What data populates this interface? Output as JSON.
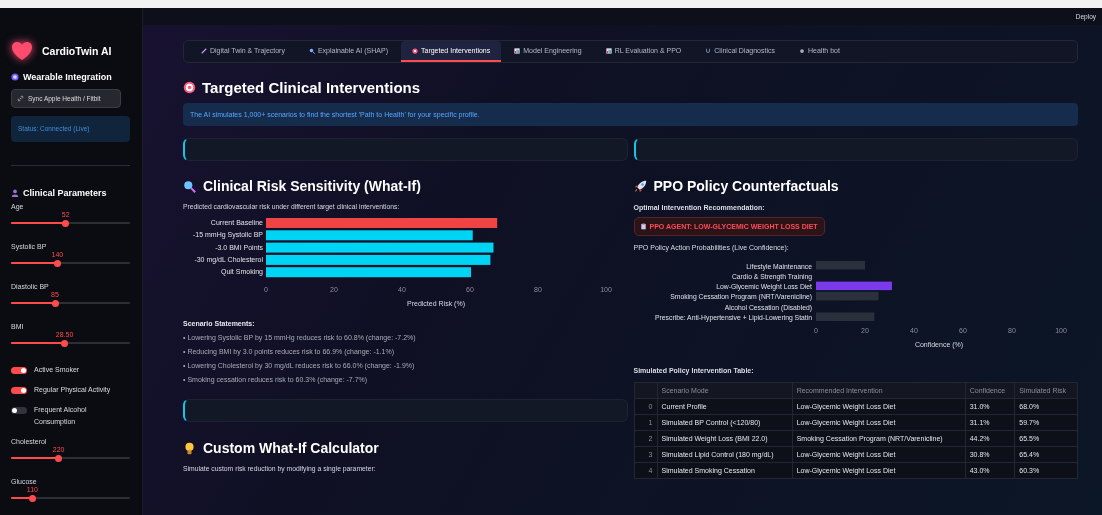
{
  "header": {
    "deploy": "Deploy"
  },
  "sidebar": {
    "app_title": "CardioTwin AI",
    "wearable_heading": "Wearable Integration",
    "sync_button": "Sync Apple Health / Fitbit",
    "status": "Status: Connected (Live)",
    "params_heading": "Clinical Parameters",
    "controls": [
      {
        "kind": "slider",
        "label": "Age",
        "value": "52",
        "level": 0.46
      },
      {
        "kind": "slider",
        "label": "Systolic BP",
        "value": "140",
        "level": 0.39
      },
      {
        "kind": "slider",
        "label": "Diastolic BP",
        "value": "85",
        "level": 0.37
      },
      {
        "kind": "slider",
        "label": "BMI",
        "value": "28.50",
        "level": 0.45
      },
      {
        "kind": "toggle",
        "label": "Active Smoker",
        "on": true
      },
      {
        "kind": "toggle",
        "label": "Regular Physical Activity",
        "on": true
      },
      {
        "kind": "toggle",
        "label": "Frequent Alcohol Consumption",
        "on": false
      },
      {
        "kind": "slider",
        "label": "Cholesterol",
        "value": "220",
        "level": 0.4
      },
      {
        "kind": "slider",
        "label": "Glucose",
        "value": "110",
        "level": 0.18
      }
    ]
  },
  "tabs": [
    {
      "label": "Digital Twin & Trajectory",
      "selected": false
    },
    {
      "label": "Explainable AI (SHAP)",
      "selected": false
    },
    {
      "label": "Targeted Interventions",
      "selected": true
    },
    {
      "label": "Model Engineering",
      "selected": false
    },
    {
      "label": "RL Evaluation & PPO",
      "selected": false
    },
    {
      "label": "Clinical Diagnostics",
      "selected": false
    },
    {
      "label": "Health bot",
      "selected": false
    }
  ],
  "page": {
    "title": "Targeted Clinical Interventions",
    "info": "The AI simulates 1,000+ scenarios to find the shortest 'Path to Health' for your specific profile."
  },
  "left": {
    "title": "Clinical Risk Sensitivity (What-If)",
    "subtitle": "Predicted cardiovascular risk under different target clinical interventions:",
    "chart_data": {
      "type": "bar",
      "orientation": "horizontal",
      "xlabel": "Predicted Risk (%)",
      "categories": [
        "Current Baseline",
        "-15 mmHg Systolic BP",
        "-3.0 BMI Points",
        "-30 mg/dL Cholesterol",
        "Quit Smoking"
      ],
      "xlim": [
        0,
        100
      ],
      "xticks": [
        0,
        20,
        40,
        60,
        80,
        100
      ],
      "series": [
        {
          "color": "#ef4444",
          "values": [
            68.0,
            null,
            null,
            null,
            null
          ]
        },
        {
          "color": "#00d4f5",
          "values": [
            null,
            60.8,
            66.9,
            66.0,
            60.3
          ]
        }
      ]
    },
    "statements_heading": "Scenario Statements:",
    "statements": [
      "• Lowering Systolic BP by 15 mmHg reduces risk to 60.8% (change: -7.2%)",
      "• Reducing BMI by 3.0 points reduces risk to 66.9% (change: -1.1%)",
      "• Lowering Cholesterol by 30 mg/dL reduces risk to 66.0% (change: -1.9%)",
      "• Smoking cessation reduces risk to 60.3% (change: -7.7%)"
    ],
    "calc_title": "Custom What-If Calculator",
    "calc_subtitle": "Simulate custom risk reduction by modifying a single parameter:"
  },
  "right": {
    "title": "PPO Policy Counterfactuals",
    "recommendation_label": "Optimal Intervention Recommendation:",
    "recommendation": "PPO AGENT: LOW-GLYCEMIC WEIGHT LOSS DIET",
    "probabilities_label": "PPO Policy Action Probabilities (Live Confidence):",
    "chart_data": {
      "type": "bar",
      "orientation": "horizontal",
      "xlabel": "Confidence (%)",
      "categories": [
        "Lifestyle Maintenance",
        "Cardio & Strength Training",
        "Low-Glycemic Weight Loss Diet",
        "Smoking Cessation Program (NRT/Varenicline)",
        "Alcohol Cessation (Disabled)",
        "Prescribe: Anti-Hypertensive + Lipid-Lowering Statin"
      ],
      "xlim": [
        0,
        100
      ],
      "xticks": [
        0,
        20,
        40,
        60,
        80,
        100
      ],
      "series": [
        {
          "color": "#2a313d",
          "values": [
            20.0,
            0,
            null,
            25.5,
            0,
            23.8
          ]
        },
        {
          "color": "#7c3aed",
          "values": [
            null,
            null,
            31.0,
            null,
            null,
            null
          ]
        }
      ]
    },
    "table_title": "Simulated Policy Intervention Table:",
    "table": {
      "columns": [
        "",
        "Scenario Mode",
        "Recommended Intervention",
        "Confidence",
        "Simulated Risk"
      ],
      "rows": [
        [
          "0",
          "Current Profile",
          "Low-Glycemic Weight Loss Diet",
          "31.0%",
          "68.0%"
        ],
        [
          "1",
          "Simulated BP Control (<120/80)",
          "Low-Glycemic Weight Loss Diet",
          "31.1%",
          "59.7%"
        ],
        [
          "2",
          "Simulated Weight Loss (BMI 22.0)",
          "Smoking Cessation Program (NRT/Varenicline)",
          "44.2%",
          "65.5%"
        ],
        [
          "3",
          "Simulated Lipid Control (180 mg/dL)",
          "Low-Glycemic Weight Loss Diet",
          "30.8%",
          "65.4%"
        ],
        [
          "4",
          "Simulated Smoking Cessation",
          "Low-Glycemic Weight Loss Diet",
          "43.0%",
          "60.3%"
        ]
      ]
    }
  }
}
